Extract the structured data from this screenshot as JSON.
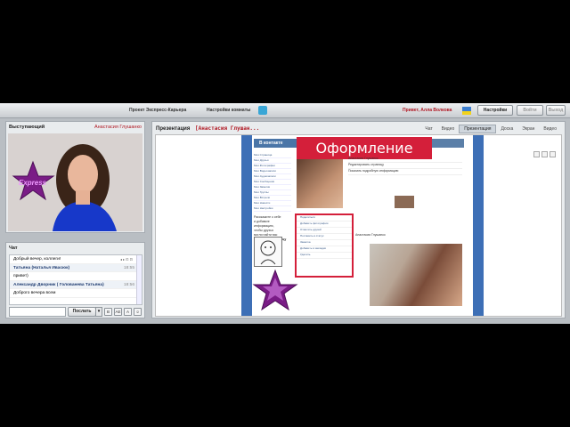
{
  "topbar": {
    "project": "Проект Экспресс-Карьера",
    "room_settings": "Настройки комнаты",
    "greeting": "Привет, Алла Волкова",
    "settings_btn": "Настройки",
    "login_btn": "Войти",
    "exit_btn": "Выход"
  },
  "speaker": {
    "label": "Выступающий",
    "name": "Анастасия Глушанко"
  },
  "chat": {
    "label": "Чат",
    "controls": "◂ ▸ ⊡ ⊡",
    "messages": [
      {
        "text": "Добрый вечер, коллеги!",
        "time": "",
        "type": "msg"
      },
      {
        "text": "Татьяна (Наталья Ивасюк)",
        "time": "18:55",
        "type": "author"
      },
      {
        "text": "привет)",
        "time": "",
        "type": "msg"
      },
      {
        "text": "Александр Дворник ( Голованева Татьяна)",
        "time": "18:56",
        "type": "author"
      },
      {
        "text": "Доброго вечера всем",
        "time": "",
        "type": "msg"
      }
    ],
    "send_label": "Послать",
    "dropdown": "▾",
    "fmt1": "B",
    "fmt2": "AE",
    "fmt3": "A",
    "fmt4": "☺"
  },
  "presentation": {
    "label": "Презентация",
    "title": "[Анастасия Глушан...",
    "tabs": [
      "Чат",
      "Видео",
      "Презентация",
      "Доска",
      "Экран",
      "Видео"
    ],
    "active_tab": 2,
    "slide": {
      "title": "Оформление",
      "vk_logo": "В контакте",
      "menu": [
        "Моя Страница",
        "Мои Друзья",
        "Мои Фотографии",
        "Мои Видеозаписи",
        "Мои Аудиозаписи",
        "Мои Сообщения",
        "Мои Заметки",
        "Мои Группы",
        "Мои Встречи",
        "Мои Новости",
        "Мои Настройки"
      ],
      "profile": [
        "Анастасия Глушанко",
        "Редактировать страницу",
        "Показать подробную информацию"
      ],
      "redbox": [
        "Поделиться",
        "Добавить фотографии",
        "Отметить друзей",
        "Поставить в статус",
        "Заметка",
        "Добавить в закладки",
        "Удалить"
      ],
      "leftinfo": [
        "Расскажите о себе",
        "и добавьте",
        "информацию,",
        "чтобы друзья",
        "могли найти вас",
        "Дополнить страницу"
      ],
      "wall": "Анастасия Глушанко"
    }
  },
  "colors": {
    "accent_red": "#b01722",
    "vk_blue": "#4a75a7",
    "slide_title_bg": "#d41f3a"
  }
}
